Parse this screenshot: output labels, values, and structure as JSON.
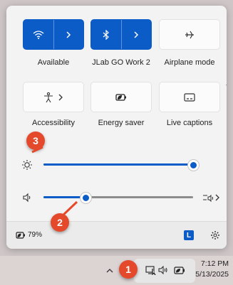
{
  "quick_settings": {
    "tiles": [
      {
        "label": "Available",
        "active": true,
        "icon": "wifi-icon",
        "expand": true
      },
      {
        "label": "JLab GO Work 2",
        "active": true,
        "icon": "bluetooth-icon",
        "expand": true
      },
      {
        "label": "Airplane mode",
        "active": false,
        "icon": "airplane-icon"
      },
      {
        "label": "Accessibility",
        "active": false,
        "icon": "accessibility-icon",
        "expand": true
      },
      {
        "label": "Energy saver",
        "active": false,
        "icon": "energy-saver-icon"
      },
      {
        "label": "Live captions",
        "active": false,
        "icon": "live-captions-icon"
      }
    ],
    "brightness": {
      "value": 100
    },
    "volume": {
      "value": 28
    },
    "battery": {
      "percent": "79%"
    },
    "profile_initial": "L"
  },
  "annotations": [
    "1",
    "2",
    "3"
  ],
  "taskbar": {
    "time": "7:12 PM",
    "date": "5/13/2025"
  },
  "colors": {
    "accent": "#0b5cc7",
    "annotation": "#e5492b"
  }
}
